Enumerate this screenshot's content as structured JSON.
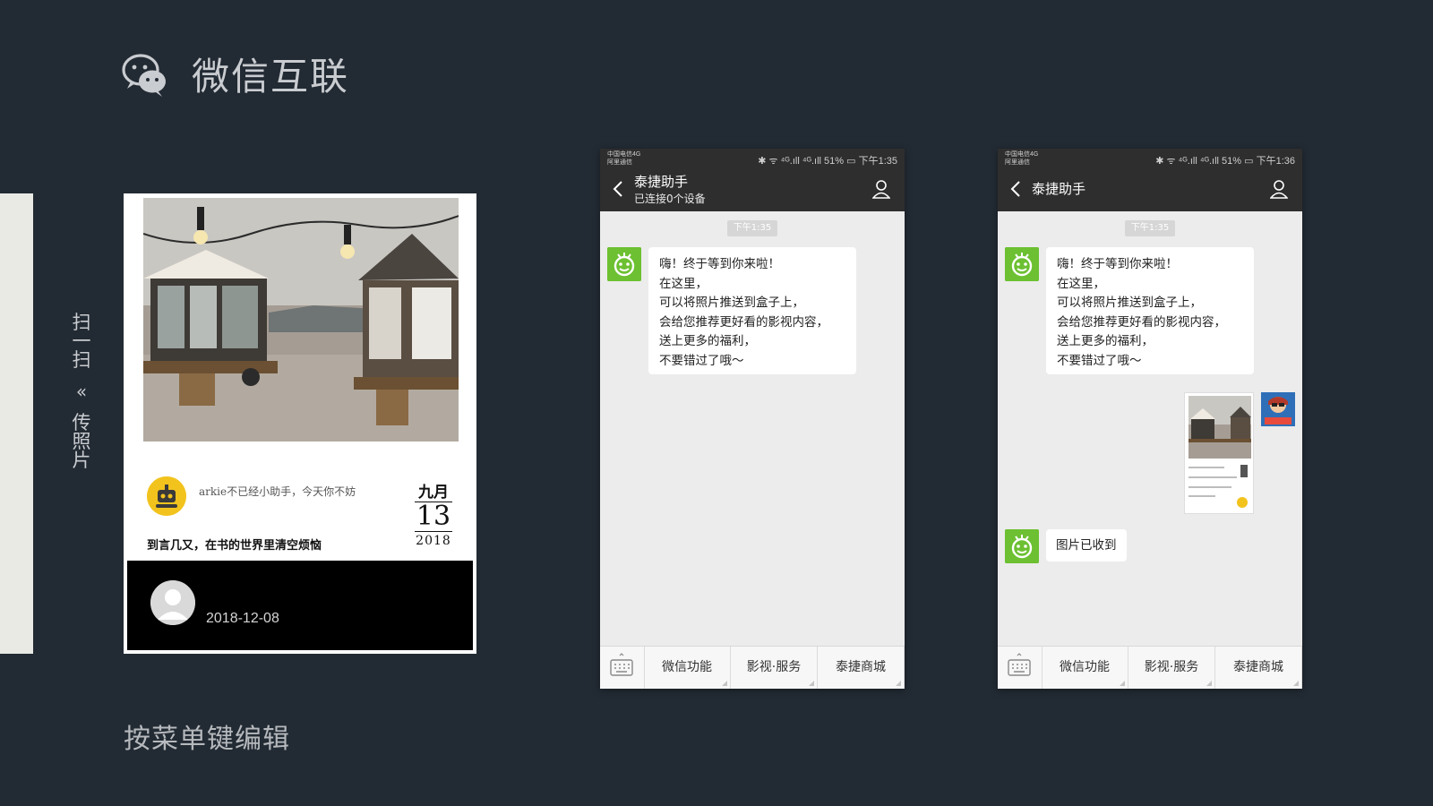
{
  "header": {
    "title": "微信互联"
  },
  "footer": {
    "hint": "按菜单键编辑"
  },
  "side": {
    "chars_top": [
      "扫",
      "一",
      "扫"
    ],
    "arrow": "«",
    "chars_bottom": [
      "传",
      "照",
      "片"
    ]
  },
  "card": {
    "message": "arkie不已经小助手，今天你不妨",
    "date_month": "九月",
    "date_day": "13",
    "date_year": "2018",
    "caption": "到言几又，在书的世界里清空烦恼",
    "footer_date": "2018-12-08"
  },
  "phone1": {
    "status_carrier_1": "中国电信4G",
    "status_carrier_2": "阿里通信",
    "status_right": "✱ ᯤ ⁴ᴳ.ıll ⁴ᴳ.ıll 51% ▭ 下午1:35",
    "title": "泰捷助手",
    "subtitle": "已连接0个设备",
    "time_chip": "下午1:35",
    "greeting_lines": [
      "嗨！终于等到你来啦！",
      "在这里，",
      "可以将照片推送到盒子上，",
      "会给您推荐更好看的影视内容，",
      "送上更多的福利，",
      "不要错过了哦～"
    ]
  },
  "phone2": {
    "status_carrier_1": "中国电信4G",
    "status_carrier_2": "阿里通信",
    "status_right": "✱ ᯤ ⁴ᴳ.ıll ⁴ᴳ.ıll 51% ▭ 下午1:36",
    "title": "泰捷助手",
    "time_chip": "下午1:35",
    "greeting_lines": [
      "嗨！终于等到你来啦！",
      "在这里，",
      "可以将照片推送到盒子上，",
      "会给您推荐更好看的影视内容，",
      "送上更多的福利，",
      "不要错过了哦～"
    ],
    "reply": "图片已收到"
  },
  "menu": [
    "微信功能",
    "影视·服务",
    "泰捷商城"
  ],
  "colors": {
    "background": "#222a33",
    "wechat_green": "#6cc031",
    "nav_dark": "#2e2e2e"
  }
}
